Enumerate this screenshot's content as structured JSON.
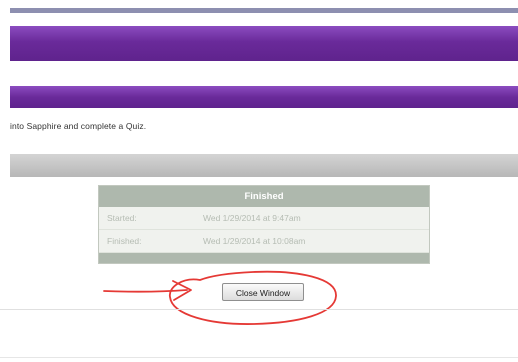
{
  "page": {
    "instruction_text": "into Sapphire and complete a Quiz."
  },
  "status_table": {
    "header": "Finished",
    "rows": [
      {
        "label": "Started:",
        "value": "Wed 1/29/2014 at 9:47am"
      },
      {
        "label": "Finished:",
        "value": "Wed 1/29/2014 at 10:08am"
      }
    ]
  },
  "buttons": {
    "close_window": "Close Window"
  },
  "colors": {
    "banner_purple": "#6a2a9a",
    "table_header": "#aeb8ad",
    "annotation_red": "#e53935"
  }
}
